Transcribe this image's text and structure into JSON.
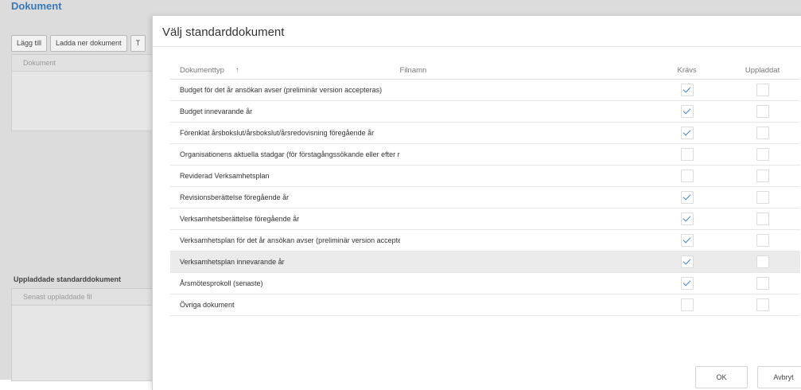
{
  "background": {
    "title": "Dokument",
    "toolbar": [
      "Lägg till",
      "Ladda ner dokument",
      "T"
    ],
    "documents_column": "Dokument",
    "uploaded_section_title": "Uppladdade standarddokument",
    "latest_file_column": "Senast uppladdade fil"
  },
  "modal": {
    "title": "Välj standarddokument",
    "columns": {
      "doc_type": "Dokumenttyp",
      "sort_indicator": "↑",
      "filename": "Filnamn",
      "required": "Krävs",
      "uploaded": "Uppladdat"
    },
    "rows": [
      {
        "type": "Budget för det år ansökan avser (preliminär version accepteras)",
        "required": true,
        "uploaded": false
      },
      {
        "type": "Budget innevarande år",
        "required": true,
        "uploaded": false
      },
      {
        "type": "Förenklat årsbokslut/årsbokslut/årsredovisning föregående år",
        "required": true,
        "uploaded": false
      },
      {
        "type": "Organisationens aktuella stadgar (för förstagångssökande eller efter rev",
        "required": false,
        "uploaded": false
      },
      {
        "type": "Reviderad Verksamhetsplan",
        "required": false,
        "uploaded": false
      },
      {
        "type": "Revisionsberättelse föregående år",
        "required": true,
        "uploaded": false
      },
      {
        "type": "Verksamhetsberättelse föregående år",
        "required": true,
        "uploaded": false
      },
      {
        "type": "Verksamhetsplan för det år ansökan avser (preliminär version accepterа",
        "required": true,
        "uploaded": false
      },
      {
        "type": "Verksamhetsplan innevarande år",
        "required": true,
        "uploaded": false,
        "selected": true
      },
      {
        "type": "Årsmötesprokoll (senaste)",
        "required": true,
        "uploaded": false
      },
      {
        "type": "Övriga dokument",
        "required": false,
        "uploaded": false
      }
    ],
    "ok_label": "OK",
    "cancel_label": "Avbryt"
  }
}
